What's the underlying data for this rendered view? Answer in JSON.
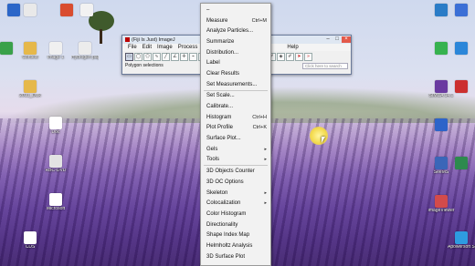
{
  "window": {
    "title": "(Fiji Is Just) ImageJ",
    "menus": [
      "File",
      "Edit",
      "Image",
      "Process",
      "Help"
    ],
    "tools": [
      "rect",
      "oval",
      "poly",
      "free",
      "line",
      "angle",
      "point",
      "wand",
      "text",
      "zoom",
      "scroll",
      "color",
      "Stk",
      "LUT",
      "",
      "",
      "",
      "",
      "",
      ""
    ],
    "status": "Polygon selections",
    "search_placeholder": "Click here to search"
  },
  "menu": {
    "top_item": "–",
    "items": [
      {
        "label": "Measure",
        "shortcut": "Ctrl+M"
      },
      {
        "label": "Analyze Particles...",
        "shortcut": ""
      },
      {
        "label": "Summarize",
        "shortcut": ""
      },
      {
        "label": "Distribution...",
        "shortcut": ""
      },
      {
        "label": "Label",
        "shortcut": ""
      },
      {
        "label": "Clear Results",
        "shortcut": ""
      },
      {
        "label": "Set Measurements...",
        "shortcut": ""
      },
      {
        "separator": true
      },
      {
        "label": "Set Scale...",
        "shortcut": ""
      },
      {
        "label": "Calibrate...",
        "shortcut": ""
      },
      {
        "label": "Histogram",
        "shortcut": "Ctrl+H"
      },
      {
        "label": "Plot Profile",
        "shortcut": "Ctrl+K"
      },
      {
        "label": "Surface Plot...",
        "shortcut": ""
      },
      {
        "label": "Gels",
        "submenu": true
      },
      {
        "label": "Tools",
        "submenu": true
      },
      {
        "separator": true
      },
      {
        "label": "3D Objects Counter",
        "shortcut": ""
      },
      {
        "label": "3D OC Options",
        "shortcut": ""
      },
      {
        "label": "Skeleton",
        "submenu": true
      },
      {
        "label": "Colocalization",
        "submenu": true
      },
      {
        "label": "Color Histogram",
        "shortcut": ""
      },
      {
        "label": "Directionality",
        "shortcut": ""
      },
      {
        "label": "Shape Index Map",
        "shortcut": ""
      },
      {
        "label": "Helmholtz Analysis",
        "shortcut": ""
      },
      {
        "label": "3D Surface Plot",
        "shortcut": ""
      }
    ]
  },
  "desktop_icons_left": [
    {
      "label": "",
      "color": "#2b66c8"
    },
    {
      "label": "",
      "color": "#e9e9e9"
    },
    {
      "label": "",
      "color": "#d94c2f"
    },
    {
      "label": "",
      "color": "#f2f2f2"
    },
    {
      "label": "",
      "color": "#3aa14a"
    },
    {
      "label": "Contest",
      "color": "#e6b84a"
    },
    {
      "label": "Image 1",
      "color": "#f0f0f0"
    },
    {
      "label": "Hydrogen paper",
      "color": "#ececec"
    },
    {
      "label": "2013_Disk",
      "color": "#e6b84a"
    },
    {
      "label": "Doc",
      "color": "#ffffff"
    },
    {
      "label": "RBC-DVD",
      "color": "#e3e3e3"
    },
    {
      "label": "Microsoft",
      "color": "#ffffff"
    },
    {
      "label": "CDS",
      "color": "#ffffff"
    }
  ],
  "desktop_icons_right": [
    {
      "label": "",
      "color": "#2a7cc7"
    },
    {
      "label": "",
      "color": "#3b6fd6"
    },
    {
      "label": "",
      "color": "#36b24f"
    },
    {
      "label": "",
      "color": "#2b86d9"
    },
    {
      "label": "SIMCA 14.1",
      "color": "#6a3aa0"
    },
    {
      "label": "",
      "color": "#cc2f2f"
    },
    {
      "label": "",
      "color": "#2d64c9"
    },
    {
      "label": "SeeMS",
      "color": "#3a66b8"
    },
    {
      "label": "",
      "color": "#2d8a4e"
    },
    {
      "label": "ImageViewer",
      "color": "#d34b4b"
    },
    {
      "label": "Apowersoft Screen",
      "color": "#2e9be0"
    }
  ]
}
